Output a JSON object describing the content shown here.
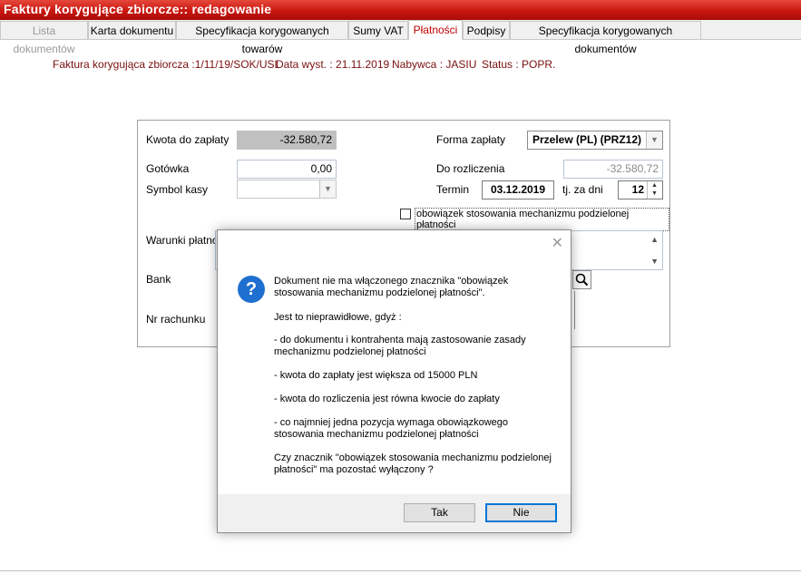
{
  "window": {
    "title": "Faktury korygujące zbiorcze:: redagowanie"
  },
  "tabs": [
    {
      "label": "Lista dokumentów"
    },
    {
      "label": "Karta dokumentu"
    },
    {
      "label": "Specyfikacja korygowanych towarów"
    },
    {
      "label": "Sumy VAT"
    },
    {
      "label": "Płatności"
    },
    {
      "label": "Podpisy"
    },
    {
      "label": "Specyfikacja korygowanych dokumentów"
    }
  ],
  "header_info": {
    "doc": "Faktura korygująca zbiorcza :1/11/19/SOK/USL",
    "date": "Data wyst. : 21.11.2019",
    "buyer": "Nabywca : JASIU",
    "status": "Status : POPR."
  },
  "form": {
    "kwota_label": "Kwota do zapłaty",
    "kwota_value": "-32.580,72",
    "gotowka_label": "Gotówka",
    "gotowka_value": "0,00",
    "symbol_kasy_label": "Symbol kasy",
    "forma_label": "Forma zapłaty",
    "forma_value": "Przelew (PL)  (PRZ12)",
    "do_rozliczenia_label": "Do rozliczenia",
    "do_rozliczenia_value": "-32.580,72",
    "termin_label": "Termin",
    "termin_value": "03.12.2019",
    "za_dni_label": "tj. za dni",
    "za_dni_value": "12",
    "split_checkbox_label": "obowiązek stosowania mechanizmu podzielonej płatności",
    "warunki_label": "Warunki płatności",
    "bank_label": "Bank",
    "nr_rachunku_label": "Nr rachunku"
  },
  "dialog": {
    "icon": "question-icon",
    "p1": "Dokument nie ma włączonego znacznika \"obowiązek stosowania mechanizmu podzielonej płatności\".",
    "p2": "Jest to nieprawidłowe, gdyż :",
    "p3": "- do dokumentu i kontrahenta mają zastosowanie zasady mechanizmu podzielonej płatności",
    "p4": "- kwota do zapłaty jest większa od 15000 PLN",
    "p5": "- kwota do rozliczenia jest równa kwocie do zapłaty",
    "p6": "- co najmniej jedna pozycja wymaga obowiązkowego stosowania mechanizmu podzielonej płatności",
    "p7": "Czy znacznik \"obowiązek stosowania mechanizmu podzielonej płatności\" ma pozostać wyłączony ?",
    "btn_yes": "Tak",
    "btn_no": "Nie"
  },
  "colors": {
    "title_bar": "#c9160f",
    "active_tab_text": "#c00000",
    "info_text": "#7a1010",
    "question_icon": "#1e6fcf",
    "default_button_border": "#0078d7"
  }
}
